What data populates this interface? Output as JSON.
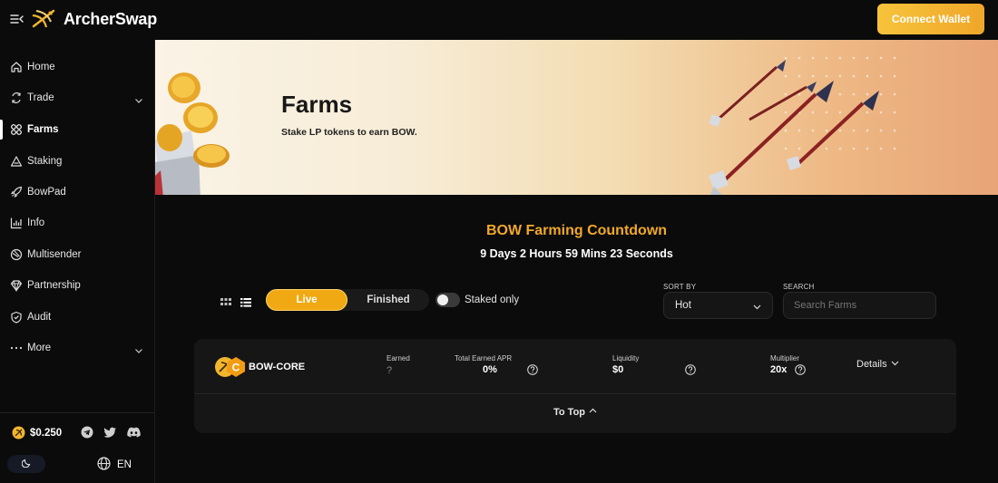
{
  "header": {
    "app_name": "ArcherSwap",
    "connect_label": "Connect Wallet"
  },
  "sidebar": {
    "items": [
      {
        "label": "Home",
        "icon": "home-icon"
      },
      {
        "label": "Trade",
        "icon": "trade-icon"
      },
      {
        "label": "Farms",
        "icon": "farms-icon"
      },
      {
        "label": "Staking",
        "icon": "staking-icon"
      },
      {
        "label": "BowPad",
        "icon": "rocket-icon"
      },
      {
        "label": "Info",
        "icon": "chart-icon"
      },
      {
        "label": "Multisender",
        "icon": "multisender-icon"
      },
      {
        "label": "Partnership",
        "icon": "diamond-icon"
      },
      {
        "label": "Audit",
        "icon": "shield-icon"
      },
      {
        "label": "More",
        "icon": "dots-icon"
      }
    ],
    "active": "Farms",
    "price": "$0.250",
    "language": "EN"
  },
  "banner": {
    "title": "Farms",
    "subtitle": "Stake LP tokens to earn BOW."
  },
  "countdown": {
    "title": "BOW Farming Countdown",
    "text": "9 Days 2 Hours 59 Mins 23 Seconds"
  },
  "filters": {
    "live_label": "Live",
    "finished_label": "Finished",
    "staked_only_label": "Staked only",
    "sort_by_label": "SORT BY",
    "sort_value": "Hot",
    "search_label": "SEARCH",
    "search_placeholder": "Search Farms"
  },
  "farms": [
    {
      "name": "BOW-CORE",
      "earned_label": "Earned",
      "earned_value": "?",
      "apr_label": "Total Earned APR",
      "apr_value": "0%",
      "liquidity_label": "Liquidity",
      "liquidity_value": "$0",
      "multiplier_label": "Multiplier",
      "multiplier_value": "20x",
      "details_label": "Details"
    }
  ],
  "to_top_label": "To Top",
  "colors": {
    "accent": "#F0A913",
    "countdown": "#F1A928",
    "background": "#0B0B0B",
    "card": "#161616"
  }
}
